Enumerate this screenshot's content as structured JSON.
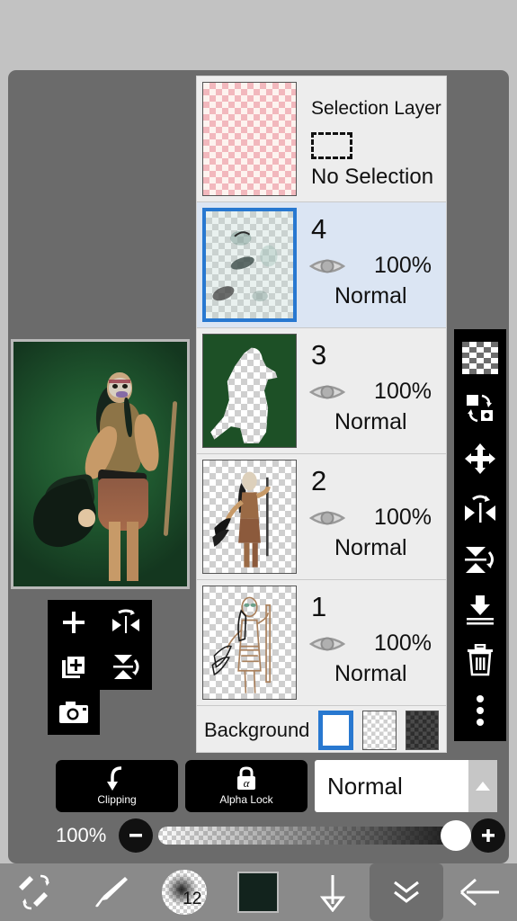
{
  "app": {
    "name": "ibisPaint X",
    "screen": "layers-panel"
  },
  "colors": {
    "outer_background": "#c2c2c2",
    "workspace": "#6b6b6b",
    "panel_background": "#ededed",
    "selected_layer_background": "#dbe5f3",
    "selection_accent": "#2878d0",
    "toolbar_background": "#8a8a8a",
    "tool_button_background": "#000000",
    "current_color": "#12231d",
    "canvas_background": "#205a30"
  },
  "selection_layer": {
    "title": "Selection Layer",
    "status": "No Selection",
    "thumbnail": "pink-checkerboard"
  },
  "layers": [
    {
      "number": "4",
      "opacity": "100%",
      "blend_mode": "Normal",
      "visible": true,
      "selected": true,
      "thumbnail": "teal-smudges-on-transparent"
    },
    {
      "number": "3",
      "opacity": "100%",
      "blend_mode": "Normal",
      "visible": true,
      "selected": false,
      "thumbnail": "green-fill-with-figure-cutout"
    },
    {
      "number": "2",
      "opacity": "100%",
      "blend_mode": "Normal",
      "visible": true,
      "selected": false,
      "thumbnail": "colored-figure-on-transparent"
    },
    {
      "number": "1",
      "opacity": "100%",
      "blend_mode": "Normal",
      "visible": true,
      "selected": false,
      "thumbnail": "line-art-figure-on-transparent"
    }
  ],
  "background_row": {
    "label": "Background",
    "options": [
      {
        "name": "white",
        "selected": true
      },
      {
        "name": "transparent-light",
        "selected": false
      },
      {
        "name": "transparent-dark",
        "selected": false
      }
    ]
  },
  "layer_actions": {
    "clipping_label": "Clipping",
    "clipping_icon": "clipping-arrow-icon",
    "alpha_lock_label": "Alpha Lock",
    "alpha_lock_icon": "alpha-lock-icon",
    "blend_mode_value": "Normal",
    "blend_mode_expand_icon": "chevron-up-icon"
  },
  "opacity": {
    "value_label": "100%",
    "value": 100,
    "minus_icon": "minus-icon",
    "plus_icon": "plus-icon"
  },
  "left_tools": [
    {
      "name": "add-layer",
      "icon": "plus-icon"
    },
    {
      "name": "flip-horizontal",
      "icon": "flip-horizontal-icon"
    },
    {
      "name": "duplicate-layer",
      "icon": "duplicate-layer-icon"
    },
    {
      "name": "flip-vertical",
      "icon": "flip-vertical-icon"
    },
    {
      "name": "camera-import",
      "icon": "camera-icon"
    }
  ],
  "right_tools": [
    {
      "name": "transparency",
      "icon": "checkerboard-icon"
    },
    {
      "name": "rotate-layer",
      "icon": "rotate-layer-icon"
    },
    {
      "name": "move-layer",
      "icon": "move-arrows-icon"
    },
    {
      "name": "flip-horizontal",
      "icon": "flip-horizontal-icon"
    },
    {
      "name": "flip-vertical",
      "icon": "flip-vertical-icon"
    },
    {
      "name": "merge-down",
      "icon": "merge-down-icon"
    },
    {
      "name": "delete-layer",
      "icon": "trash-icon"
    },
    {
      "name": "more-options",
      "icon": "more-vertical-icon"
    }
  ],
  "bottom_bar": {
    "items": [
      {
        "name": "undo-redo-eraser",
        "icon": "pen-eraser-swap-icon",
        "active": false
      },
      {
        "name": "brush-tool",
        "icon": "brush-icon",
        "active": false
      },
      {
        "name": "brush-size",
        "icon": "brush-preview-icon",
        "active": false,
        "value": "12"
      },
      {
        "name": "color-swatch",
        "icon": "color-swatch-icon",
        "active": false,
        "value": "#12231d"
      },
      {
        "name": "layer-down",
        "icon": "arrow-down-icon",
        "active": false
      },
      {
        "name": "collapse-panel",
        "icon": "double-chevron-down-icon",
        "active": true
      },
      {
        "name": "back",
        "icon": "arrow-left-icon",
        "active": false
      }
    ]
  }
}
